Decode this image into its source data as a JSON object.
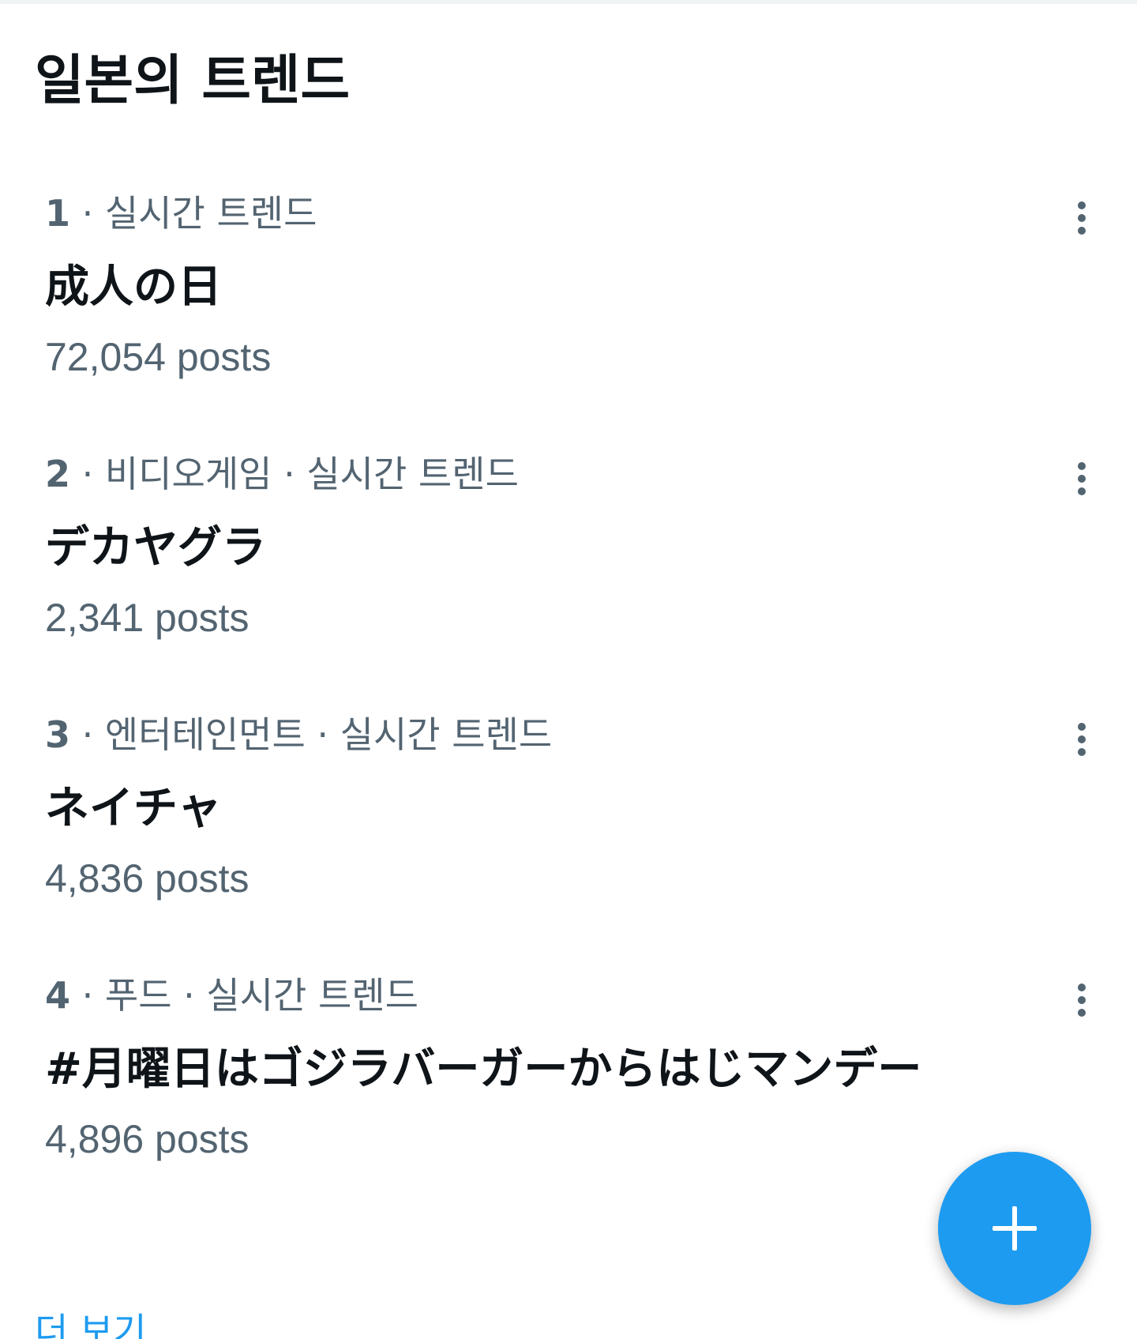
{
  "header": {
    "title": "일본의 트렌드"
  },
  "trends": [
    {
      "rank": "1",
      "context": " · 실시간 트렌드",
      "topic": "成人の日",
      "post_count": "72,054 posts"
    },
    {
      "rank": "2",
      "context": " · 비디오게임 · 실시간 트렌드",
      "topic": "デカヤグラ",
      "post_count": "2,341 posts"
    },
    {
      "rank": "3",
      "context": " · 엔터테인먼트 · 실시간 트렌드",
      "topic": "ネイチャ",
      "post_count": "4,836 posts"
    },
    {
      "rank": "4",
      "context": " · 푸드 · 실시간 트렌드",
      "topic": "#月曜日はゴジラバーガーからはじマンデー",
      "post_count": "4,896 posts"
    }
  ],
  "footer": {
    "show_more": "더 보기"
  },
  "icons": {
    "more": "more-vertical-icon",
    "compose": "plus-icon"
  },
  "colors": {
    "accent": "#1d9bf0",
    "text_primary": "#0f1419",
    "text_secondary": "#536471",
    "divider": "#eff3f4"
  }
}
